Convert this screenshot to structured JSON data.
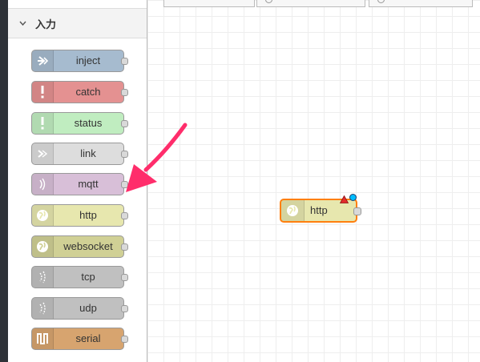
{
  "palette": {
    "category_label": "入力",
    "nodes": [
      {
        "label": "inject",
        "color": "#a6bbcf",
        "icon": "inject-arrow-icon"
      },
      {
        "label": "catch",
        "color": "#e49191",
        "icon": "exclamation-icon"
      },
      {
        "label": "status",
        "color": "#c0edc0",
        "icon": "exclamation-icon"
      },
      {
        "label": "link",
        "color": "#dddddd",
        "icon": "link-icon"
      },
      {
        "label": "mqtt",
        "color": "#d8bfd8",
        "icon": "bridge-icon"
      },
      {
        "label": "http",
        "color": "#e7e7ae",
        "icon": "globe-icon"
      },
      {
        "label": "websocket",
        "color": "#e7e7ae",
        "icon": "globe-icon"
      },
      {
        "label": "tcp",
        "color": "#c0c0c0",
        "icon": "bridge-icon"
      },
      {
        "label": "udp",
        "color": "#c0c0c0",
        "icon": "bridge-icon"
      },
      {
        "label": "serial",
        "color": "#d7a46f",
        "icon": "serial-icon"
      }
    ]
  },
  "workspace": {
    "flow_node": {
      "label": "http",
      "color": "#e7e7ae",
      "selected_border": "#ff7f0e"
    }
  },
  "annotation": {
    "arrow_color": "#ff2d6b"
  }
}
